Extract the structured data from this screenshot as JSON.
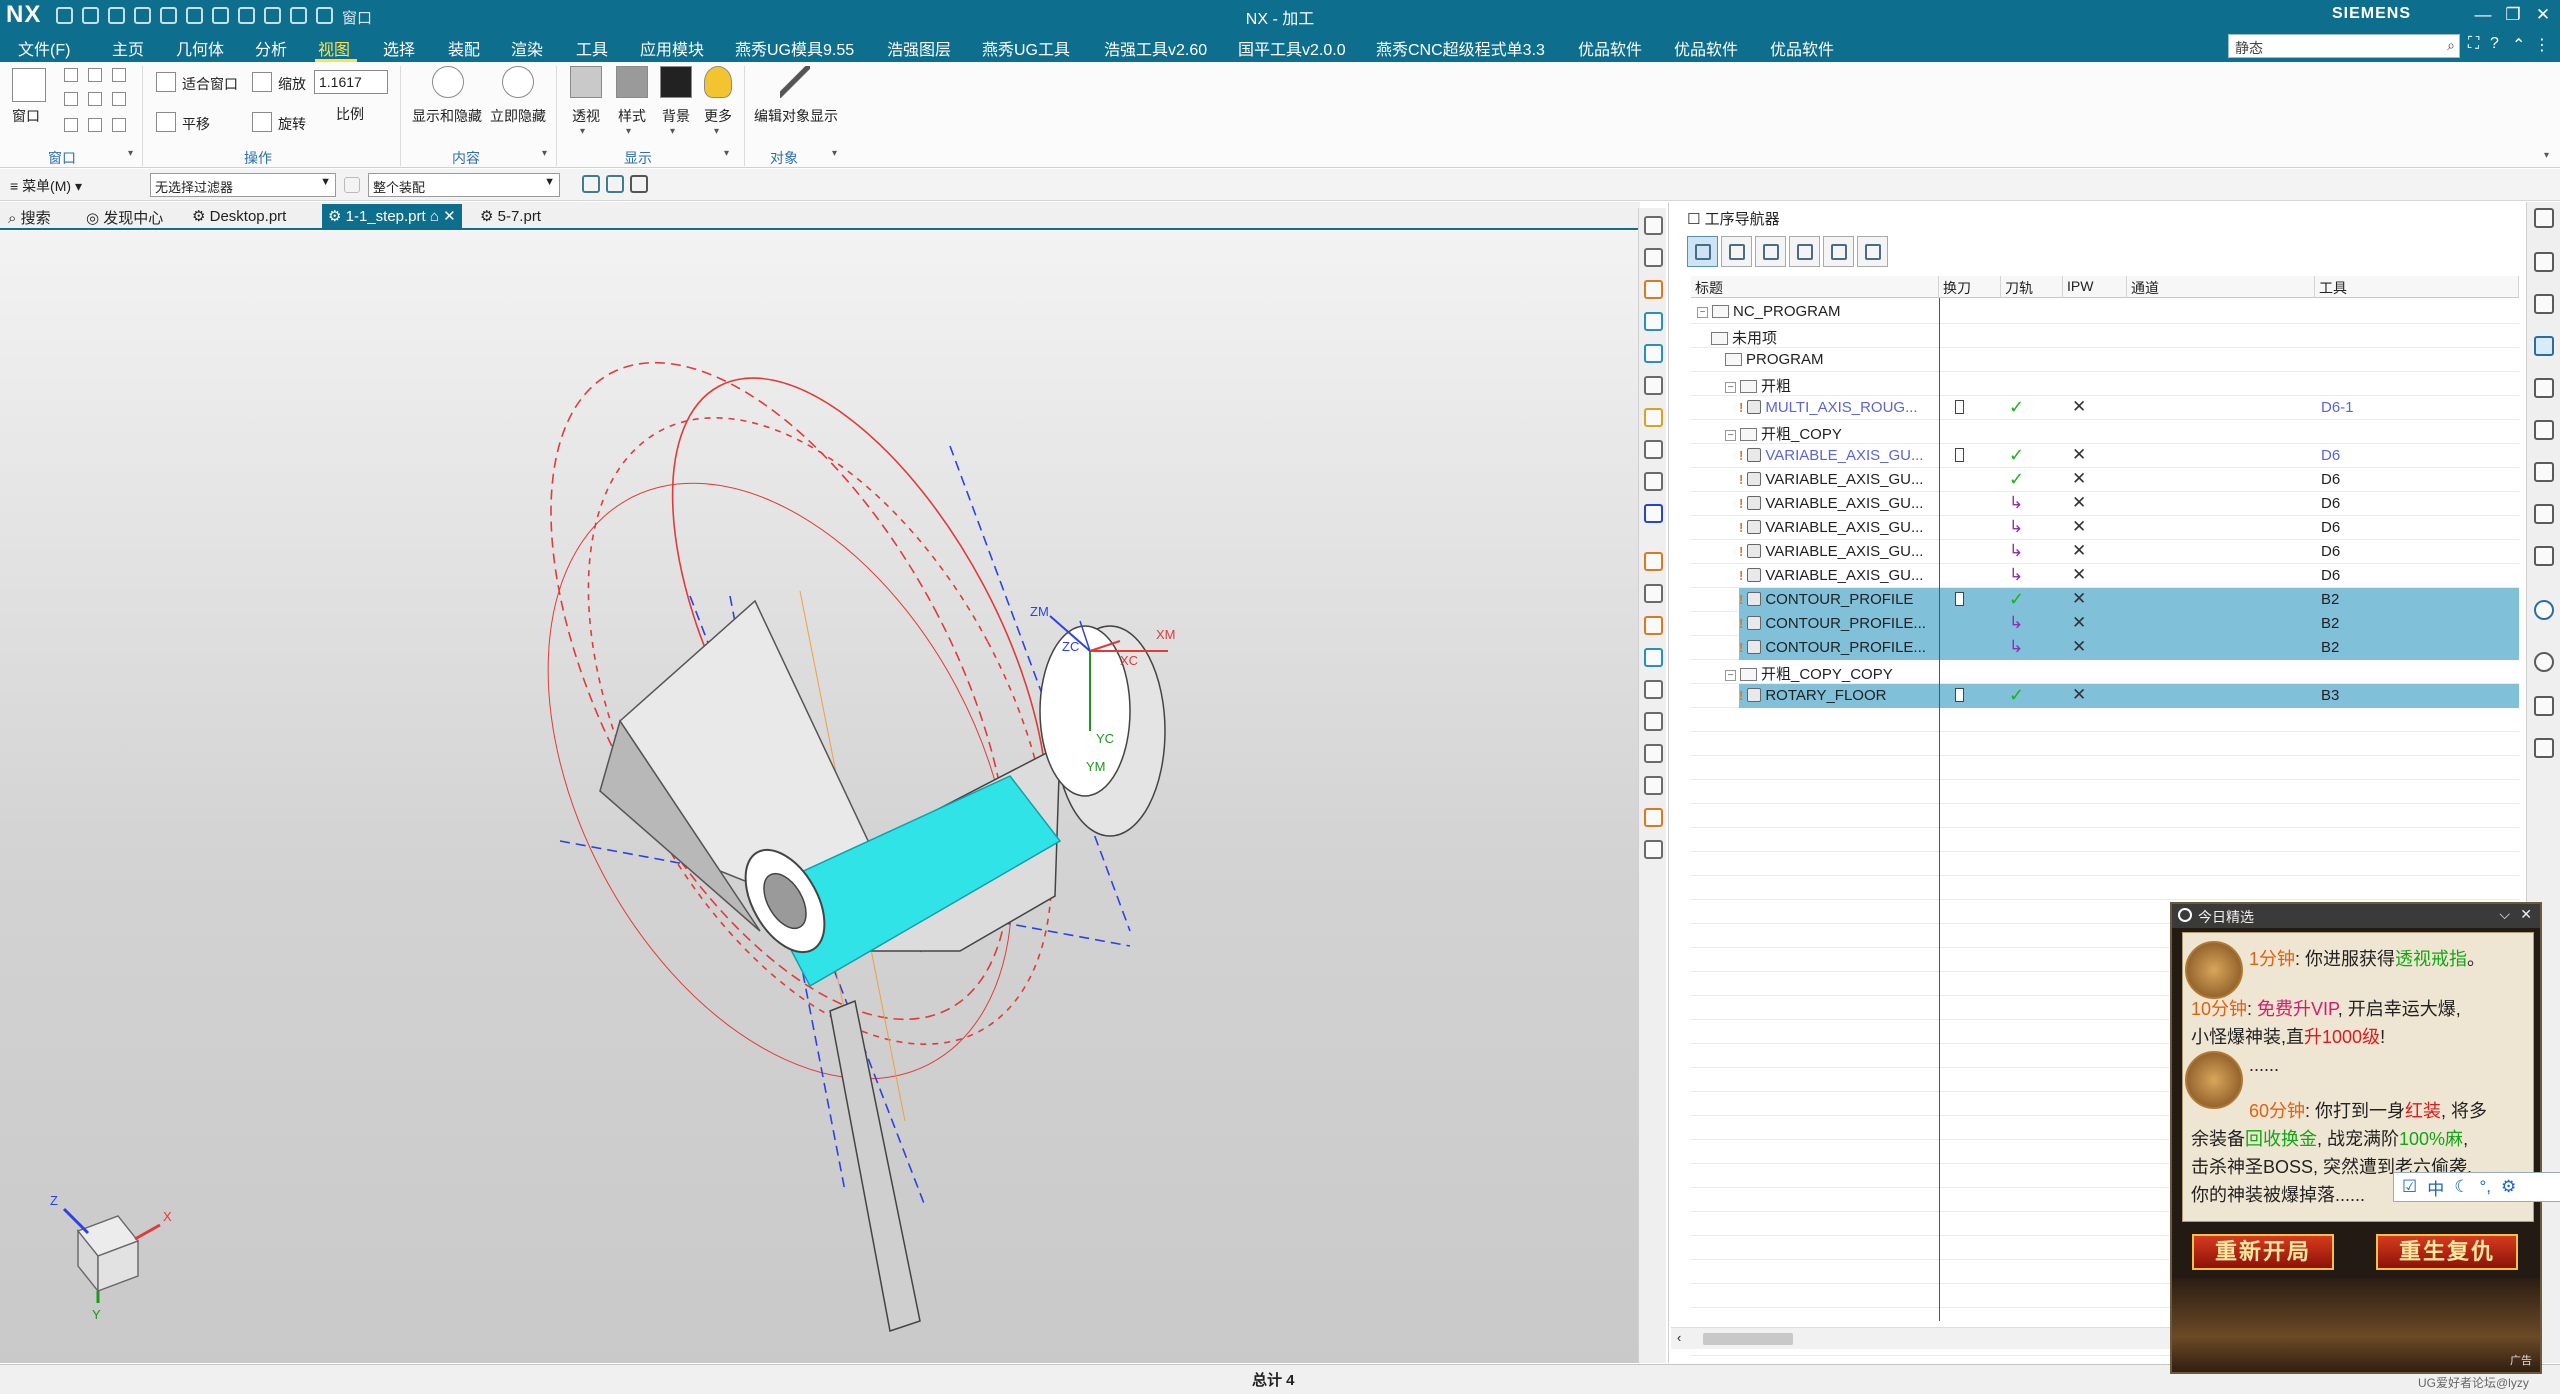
{
  "titlebar": {
    "logo": "NX",
    "window_label": "窗口",
    "title": "NX - 加工",
    "brand": "SIEMENS",
    "min": "—",
    "restore": "❐",
    "close": "✕"
  },
  "menu": {
    "items": [
      "文件(F)",
      "主页",
      "几何体",
      "分析",
      "视图",
      "选择",
      "装配",
      "渲染",
      "工具",
      "应用模块",
      "燕秀UG模具9.55",
      "浩强图层",
      "燕秀UG工具",
      "浩强工具v2.60",
      "国平工具v2.0.0",
      "燕秀CNC超级程式单3.3",
      "优品软件",
      "优品软件",
      "优品软件"
    ],
    "active": "视图",
    "search_value": "静态"
  },
  "ribbon": {
    "window": {
      "label": "窗口",
      "group": "窗口"
    },
    "operate": {
      "fit": "适合窗口",
      "zoom": "缩放",
      "zoom_value": "1.1617",
      "pan": "平移",
      "rotate": "旋转",
      "scale": "比例",
      "group": "操作"
    },
    "content": {
      "show_hide": "显示和隐藏",
      "immediate_hide": "立即隐藏",
      "group": "内容"
    },
    "display": {
      "perspective": "透视",
      "style": "样式",
      "background": "背景",
      "more": "更多",
      "group": "显示"
    },
    "object": {
      "edit": "编辑对象显示",
      "group": "对象"
    }
  },
  "selection": {
    "menu_label": "菜单(M)",
    "filter_value": "无选择过滤器",
    "scope_value": "整个装配"
  },
  "tabs": [
    {
      "label": "搜索"
    },
    {
      "label": "发现中心"
    },
    {
      "label": "Desktop.prt"
    },
    {
      "label": "1-1_step.prt"
    },
    {
      "label": "5-7.prt"
    }
  ],
  "viewport": {
    "axes_labels": {
      "zm": "ZM",
      "zc": "ZC",
      "xc": "XC",
      "xm": "XM",
      "yc": "YC",
      "ym": "YM"
    },
    "triad": {
      "z": "Z",
      "x": "X",
      "y": "Y"
    }
  },
  "navigator": {
    "title": "工序导航器",
    "columns": [
      "标题",
      "换刀",
      "刀轨",
      "IPW",
      "通道",
      "工具"
    ],
    "rows": [
      {
        "name": "NC_PROGRAM",
        "indent": 0,
        "kind": "folder",
        "expander": "−"
      },
      {
        "name": "未用项",
        "indent": 1,
        "kind": "folder"
      },
      {
        "name": "PROGRAM",
        "indent": 2,
        "kind": "folder"
      },
      {
        "name": "开粗",
        "indent": 2,
        "kind": "folder",
        "expander": "−"
      },
      {
        "name": "MULTI_AXIS_ROUG...",
        "indent": 3,
        "kind": "op",
        "tc": true,
        "path": "check",
        "ipw": "x",
        "tool": "D6-1",
        "blue": true
      },
      {
        "name": "开粗_COPY",
        "indent": 2,
        "kind": "folder",
        "expander": "−"
      },
      {
        "name": "VARIABLE_AXIS_GU...",
        "indent": 3,
        "kind": "op",
        "tc": true,
        "path": "check",
        "ipw": "x",
        "tool": "D6",
        "blue": true
      },
      {
        "name": "VARIABLE_AXIS_GU...",
        "indent": 3,
        "kind": "op",
        "path": "check",
        "ipw": "x",
        "tool": "D6"
      },
      {
        "name": "VARIABLE_AXIS_GU...",
        "indent": 3,
        "kind": "op",
        "path": "arrow",
        "ipw": "x",
        "tool": "D6"
      },
      {
        "name": "VARIABLE_AXIS_GU...",
        "indent": 3,
        "kind": "op",
        "path": "arrow",
        "ipw": "x",
        "tool": "D6"
      },
      {
        "name": "VARIABLE_AXIS_GU...",
        "indent": 3,
        "kind": "op",
        "path": "arrow",
        "ipw": "x",
        "tool": "D6"
      },
      {
        "name": "VARIABLE_AXIS_GU...",
        "indent": 3,
        "kind": "op",
        "path": "arrow",
        "ipw": "x",
        "tool": "D6"
      },
      {
        "name": "CONTOUR_PROFILE",
        "indent": 3,
        "kind": "op",
        "tc": true,
        "path": "check",
        "ipw": "x",
        "tool": "B2",
        "selected": true
      },
      {
        "name": "CONTOUR_PROFILE...",
        "indent": 3,
        "kind": "op",
        "path": "arrow",
        "ipw": "x",
        "tool": "B2",
        "selected": true
      },
      {
        "name": "CONTOUR_PROFILE...",
        "indent": 3,
        "kind": "op",
        "path": "arrow",
        "ipw": "x",
        "tool": "B2",
        "selected": true
      },
      {
        "name": "开粗_COPY_COPY",
        "indent": 2,
        "kind": "folder",
        "expander": "−"
      },
      {
        "name": "ROTARY_FLOOR",
        "indent": 3,
        "kind": "op",
        "tc": true,
        "path": "check",
        "ipw": "x",
        "tool": "B3",
        "selected": true
      }
    ]
  },
  "status": {
    "total": "总计 4"
  },
  "ad": {
    "header": "今日精选",
    "line1_time": "1分钟",
    "line1_text": ": 你进服获得",
    "line1_item": "透视戒指",
    "line1_end": "。",
    "line2_time": "10分钟",
    "line2_sep": ": ",
    "line2_vip": "免费升VIP",
    "line2_rest": ", 开启幸运大爆,",
    "line3_a": "小怪爆神装,直",
    "line3_b": "升1000级",
    "line3_c": "!",
    "line4": "......",
    "line5_time": "60分钟",
    "line5_a": ": 你打到一身",
    "line5_b": "红装",
    "line5_c": ", 将多",
    "line6_a": "余装备",
    "line6_b": "回收换金",
    "line6_c": ", 战宠满阶",
    "line6_d": "100%麻",
    "line6_e": ",",
    "line7": "击杀神圣BOSS, 突然遭到老六偷袭,",
    "line8": "你的神装被爆掉落......",
    "btn_restart": "重新开局",
    "btn_revenge": "重生复仇",
    "adtag": "广告"
  },
  "ime": {
    "lang": "中"
  },
  "watermark": "UG爱好者论坛@lyzy"
}
